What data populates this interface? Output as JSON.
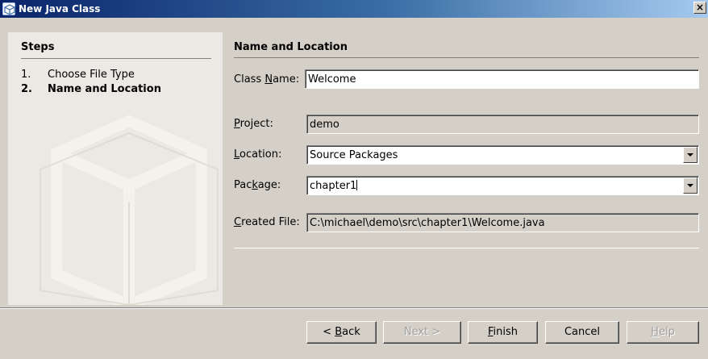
{
  "window": {
    "title": "New Java Class",
    "close_label": "×"
  },
  "steps": {
    "heading": "Steps",
    "items": [
      {
        "number": "1.",
        "label": "Choose File Type",
        "current": false
      },
      {
        "number": "2.",
        "label": "Name and Location",
        "current": true
      }
    ]
  },
  "form": {
    "heading": "Name and Location",
    "class_name": {
      "label_pre": "Class ",
      "label_mnemonic": "N",
      "label_post": "ame:",
      "value": "Welcome"
    },
    "project": {
      "label_pre": "",
      "label_mnemonic": "P",
      "label_post": "roject:",
      "value": "demo"
    },
    "location": {
      "label_pre": "",
      "label_mnemonic": "L",
      "label_post": "ocation:",
      "value": "Source Packages"
    },
    "package": {
      "label_pre": "Pac",
      "label_mnemonic": "k",
      "label_post": "age:",
      "value": "chapter1"
    },
    "created_file": {
      "label_pre": "",
      "label_mnemonic": "C",
      "label_post": "reated File:",
      "value": "C:\\michael\\demo\\src\\chapter1\\Welcome.java"
    }
  },
  "buttons": {
    "back": {
      "pre": "< ",
      "mnemonic": "B",
      "post": "ack"
    },
    "next": {
      "label": "Next >"
    },
    "finish": {
      "pre": "",
      "mnemonic": "F",
      "post": "inish"
    },
    "cancel": {
      "label": "Cancel"
    },
    "help": {
      "pre": "",
      "mnemonic": "H",
      "post": "elp"
    }
  },
  "colors": {
    "titlebar_start": "#0a246a",
    "titlebar_end": "#a6caf0",
    "dialog_bg": "#d4d0c8",
    "steps_bg": "#ece9e4"
  },
  "icons": {
    "app": "netbeans-cube-icon",
    "combo_arrow": "chevron-down-icon"
  }
}
